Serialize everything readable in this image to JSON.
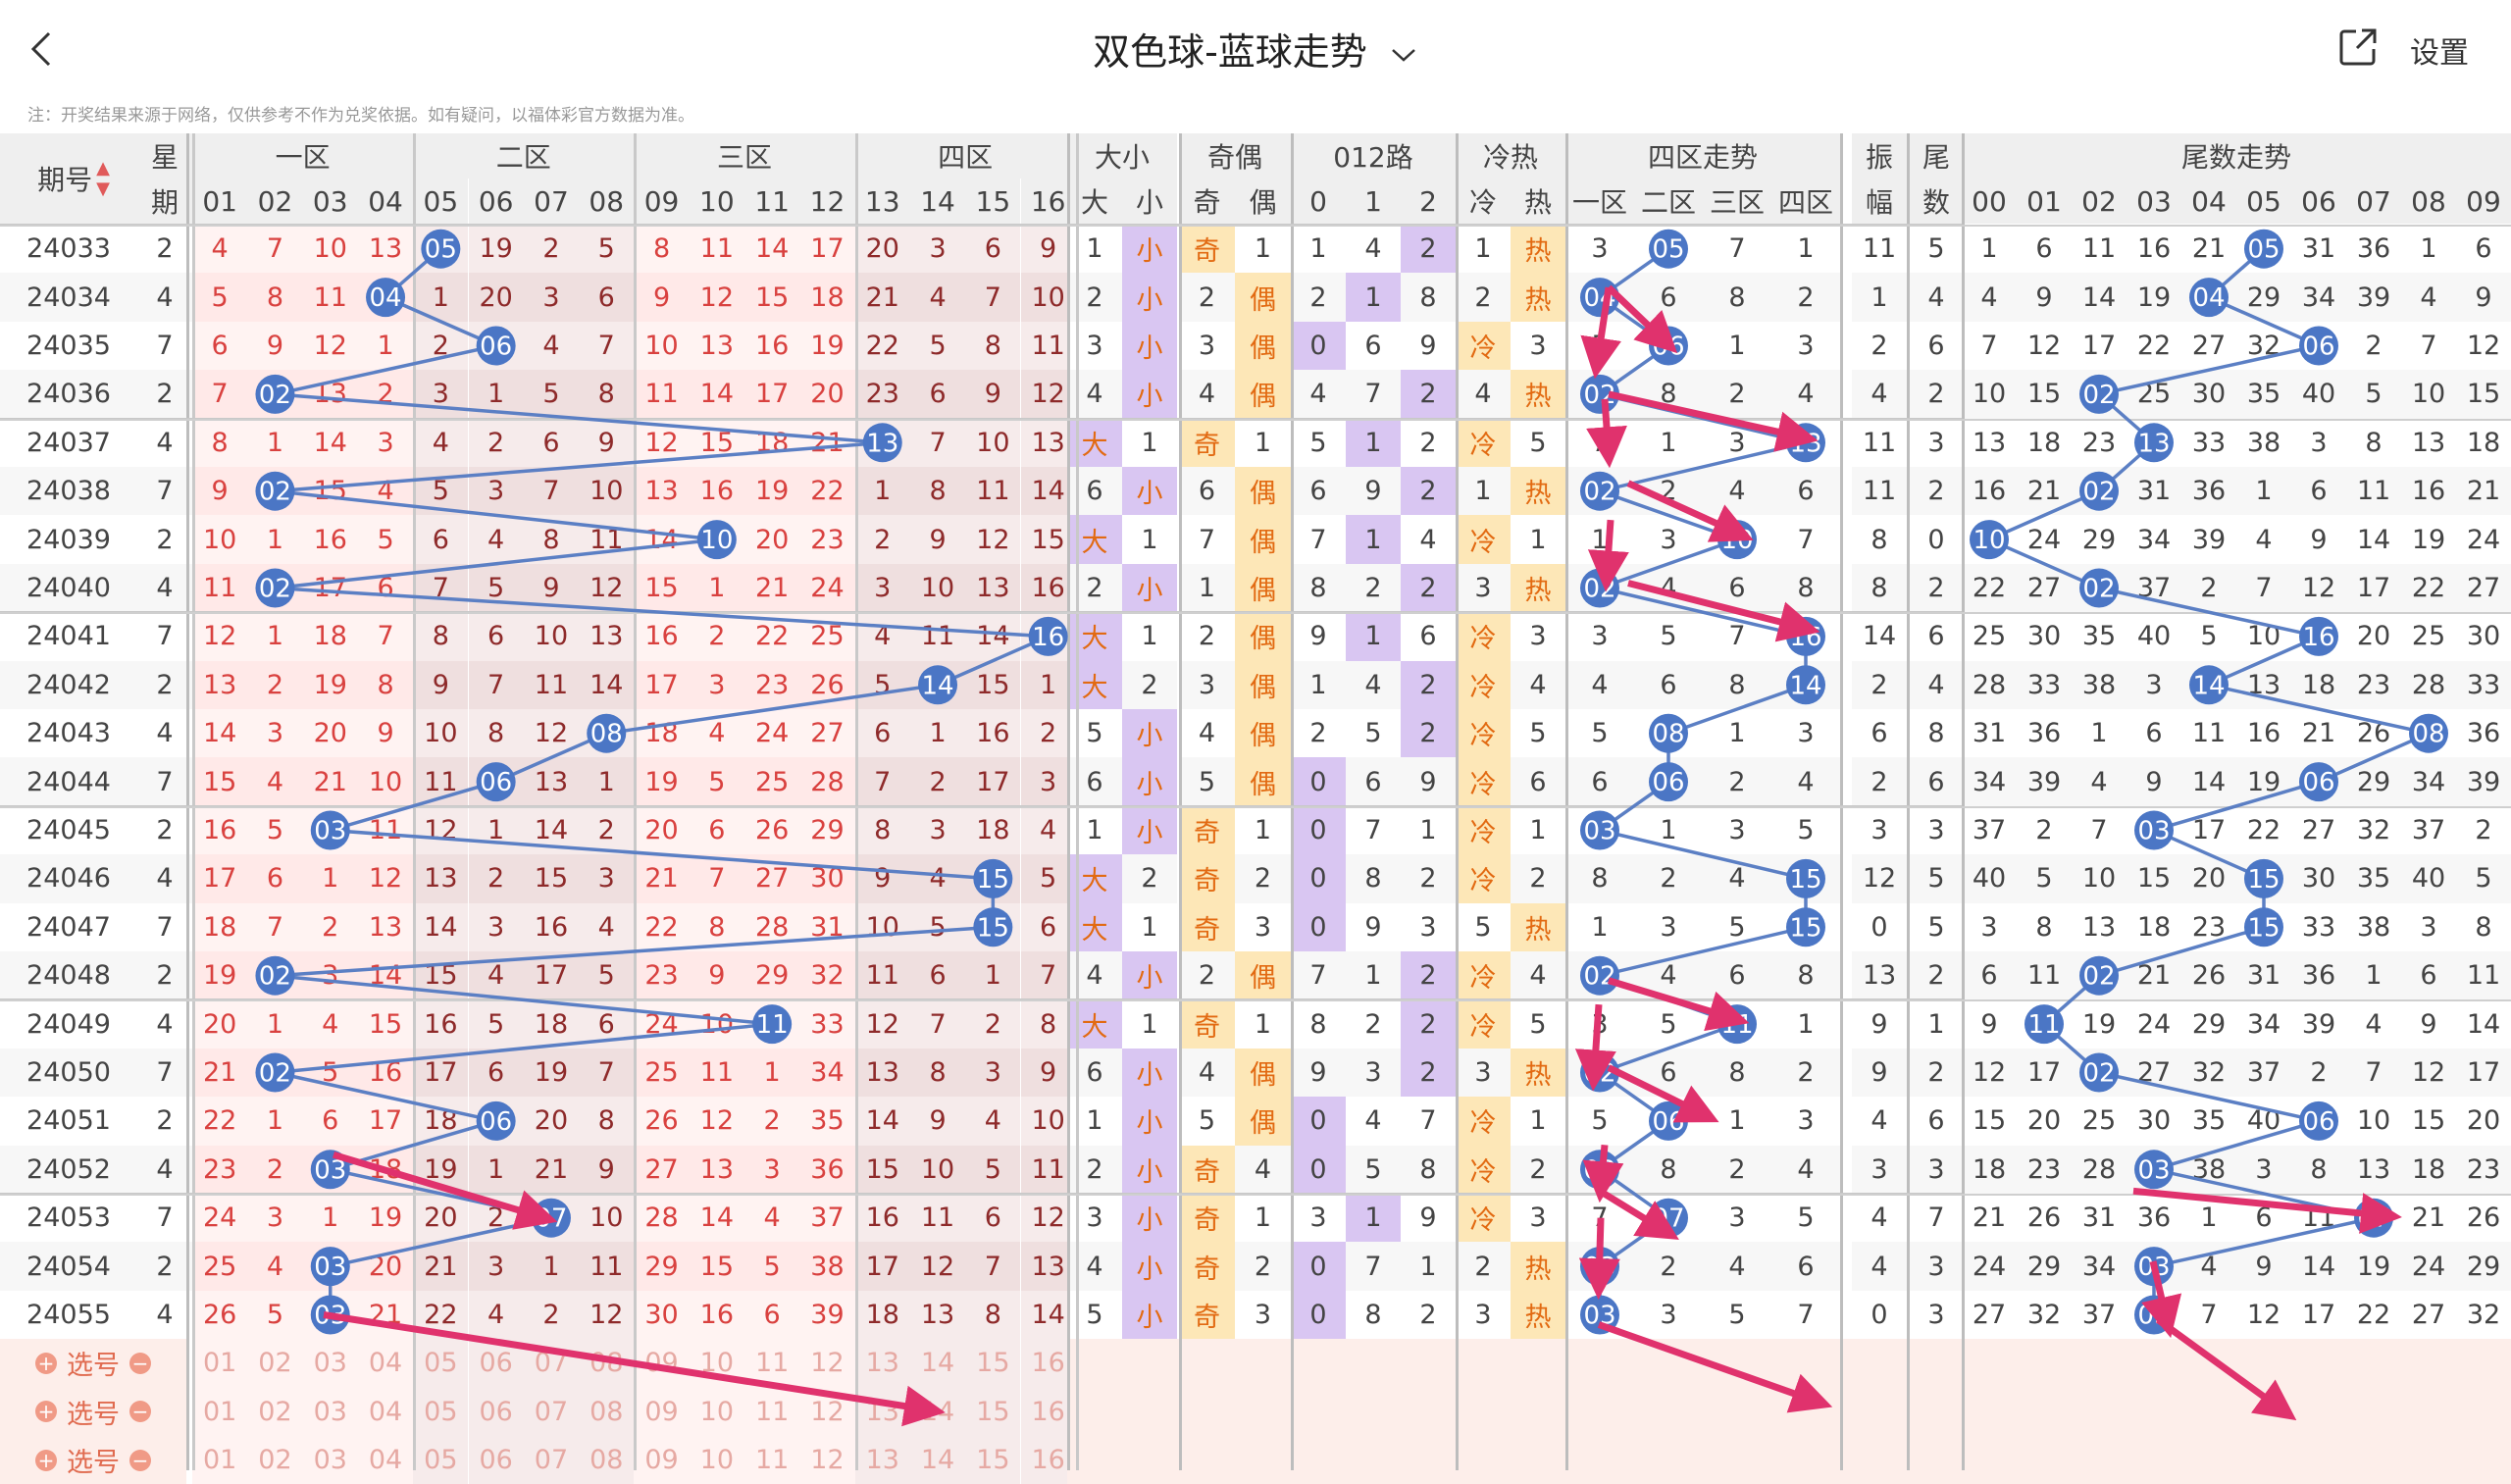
{
  "header": {
    "title": "双色球-蓝球走势",
    "settings": "设置",
    "notice": "注：开奖结果来源于网络，仅供参考不作为兑奖依据。如有疑问，以福体彩官方数据为准。"
  },
  "columns": {
    "group_labels": [
      "期号",
      "星",
      "一区",
      "二区",
      "三区",
      "四区",
      "大小",
      "奇偶",
      "012路",
      "冷热",
      "四区走势",
      "振",
      "尾",
      "尾数走势"
    ],
    "sub_labels": {
      "xing": "期",
      "zhen": "幅",
      "wei": "数",
      "daxiao": [
        "大",
        "小"
      ],
      "jiou": [
        "奇",
        "偶"
      ],
      "lu": [
        "0",
        "1",
        "2"
      ],
      "lengre": [
        "冷",
        "热"
      ],
      "zones": [
        "一区",
        "二区",
        "三区",
        "四区"
      ],
      "balls": [
        "01",
        "02",
        "03",
        "04",
        "05",
        "06",
        "07",
        "08",
        "09",
        "10",
        "11",
        "12",
        "13",
        "14",
        "15",
        "16"
      ],
      "tails": [
        "00",
        "01",
        "02",
        "03",
        "04",
        "05",
        "06",
        "07",
        "08",
        "09"
      ]
    }
  },
  "rows": [
    {
      "id": "24033",
      "star": 2,
      "ball": 5,
      "zone": 2,
      "tail": 5,
      "dx": "小",
      "jo": "奇",
      "lu": 2,
      "lr": "热",
      "zhen": 11
    },
    {
      "id": "24034",
      "star": 4,
      "ball": 4,
      "zone": 1,
      "tail": 4,
      "dx": "小",
      "jo": "偶",
      "lu": 1,
      "lr": "热",
      "zhen": 1
    },
    {
      "id": "24035",
      "star": 7,
      "ball": 6,
      "zone": 2,
      "tail": 6,
      "dx": "小",
      "jo": "偶",
      "lu": 0,
      "lr": "冷",
      "zhen": 2
    },
    {
      "id": "24036",
      "star": 2,
      "ball": 2,
      "zone": 1,
      "tail": 2,
      "dx": "小",
      "jo": "偶",
      "lu": 2,
      "lr": "热",
      "zhen": 4
    },
    {
      "id": "24037",
      "star": 4,
      "ball": 13,
      "zone": 4,
      "tail": 3,
      "dx": "大",
      "jo": "奇",
      "lu": 1,
      "lr": "冷",
      "zhen": 11
    },
    {
      "id": "24038",
      "star": 7,
      "ball": 2,
      "zone": 1,
      "tail": 2,
      "dx": "小",
      "jo": "偶",
      "lu": 2,
      "lr": "热",
      "zhen": 11
    },
    {
      "id": "24039",
      "star": 2,
      "ball": 10,
      "zone": 3,
      "tail": 0,
      "dx": "大",
      "jo": "偶",
      "lu": 1,
      "lr": "冷",
      "zhen": 8
    },
    {
      "id": "24040",
      "star": 4,
      "ball": 2,
      "zone": 1,
      "tail": 2,
      "dx": "小",
      "jo": "偶",
      "lu": 2,
      "lr": "热",
      "zhen": 8
    },
    {
      "id": "24041",
      "star": 7,
      "ball": 16,
      "zone": 4,
      "tail": 6,
      "dx": "大",
      "jo": "偶",
      "lu": 1,
      "lr": "冷",
      "zhen": 14
    },
    {
      "id": "24042",
      "star": 2,
      "ball": 14,
      "zone": 4,
      "tail": 4,
      "dx": "大",
      "jo": "偶",
      "lu": 2,
      "lr": "冷",
      "zhen": 2
    },
    {
      "id": "24043",
      "star": 4,
      "ball": 8,
      "zone": 2,
      "tail": 8,
      "dx": "小",
      "jo": "偶",
      "lu": 2,
      "lr": "冷",
      "zhen": 6
    },
    {
      "id": "24044",
      "star": 7,
      "ball": 6,
      "zone": 2,
      "tail": 6,
      "dx": "小",
      "jo": "偶",
      "lu": 0,
      "lr": "冷",
      "zhen": 2
    },
    {
      "id": "24045",
      "star": 2,
      "ball": 3,
      "zone": 1,
      "tail": 3,
      "dx": "小",
      "jo": "奇",
      "lu": 0,
      "lr": "冷",
      "zhen": 3
    },
    {
      "id": "24046",
      "star": 4,
      "ball": 15,
      "zone": 4,
      "tail": 5,
      "dx": "大",
      "jo": "奇",
      "lu": 0,
      "lr": "冷",
      "zhen": 12
    },
    {
      "id": "24047",
      "star": 7,
      "ball": 15,
      "zone": 4,
      "tail": 5,
      "dx": "大",
      "jo": "奇",
      "lu": 0,
      "lr": "热",
      "zhen": 0
    },
    {
      "id": "24048",
      "star": 2,
      "ball": 2,
      "zone": 1,
      "tail": 2,
      "dx": "小",
      "jo": "偶",
      "lu": 2,
      "lr": "冷",
      "zhen": 13
    },
    {
      "id": "24049",
      "star": 4,
      "ball": 11,
      "zone": 3,
      "tail": 1,
      "dx": "大",
      "jo": "奇",
      "lu": 2,
      "lr": "冷",
      "zhen": 9
    },
    {
      "id": "24050",
      "star": 7,
      "ball": 2,
      "zone": 1,
      "tail": 2,
      "dx": "小",
      "jo": "偶",
      "lu": 2,
      "lr": "热",
      "zhen": 9
    },
    {
      "id": "24051",
      "star": 2,
      "ball": 6,
      "zone": 2,
      "tail": 6,
      "dx": "小",
      "jo": "偶",
      "lu": 0,
      "lr": "冷",
      "zhen": 4
    },
    {
      "id": "24052",
      "star": 4,
      "ball": 3,
      "zone": 1,
      "tail": 3,
      "dx": "小",
      "jo": "奇",
      "lu": 0,
      "lr": "冷",
      "zhen": 3
    },
    {
      "id": "24053",
      "star": 7,
      "ball": 7,
      "zone": 2,
      "tail": 7,
      "dx": "小",
      "jo": "奇",
      "lu": 1,
      "lr": "冷",
      "zhen": 4
    },
    {
      "id": "24054",
      "star": 2,
      "ball": 3,
      "zone": 1,
      "tail": 3,
      "dx": "小",
      "jo": "奇",
      "lu": 0,
      "lr": "热",
      "zhen": 4
    },
    {
      "id": "24055",
      "star": 4,
      "ball": 3,
      "zone": 1,
      "tail": 3,
      "dx": "小",
      "jo": "奇",
      "lu": 0,
      "lr": "热",
      "zhen": 0
    }
  ],
  "select_rows": [
    "选号",
    "选号",
    "选号"
  ],
  "colors": {
    "ball": "#4b76c5",
    "line": "#5b7fc4",
    "arrow": "#e0326d",
    "red_num": "#d9413f",
    "dark_num": "#8e2a2a",
    "orange": "#e26a12",
    "purple_bg": "#d9c6f2",
    "yellow_bg": "#fde7b7",
    "pink_bg": "#fff0ef",
    "gray_zone": "#f2e6e6",
    "select_bg": "#fdeeea"
  }
}
